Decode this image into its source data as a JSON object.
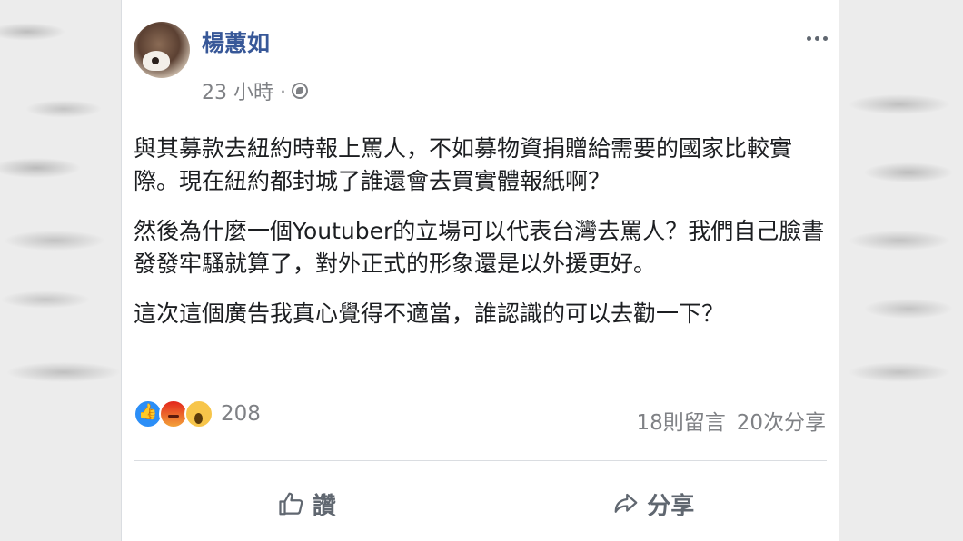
{
  "post": {
    "author": "楊蕙如",
    "timestamp": "23 小時 ·",
    "paragraphs": [
      "與其募款去紐約時報上罵人，不如募物資捐贈給需要的國家比較實際。現在紐約都封城了誰還會去買實體報紙啊？",
      "然後為什麼一個Youtuber的立場可以代表台灣去罵人？我們自己臉書發發牢騷就算了，對外正式的形象還是以外援更好。",
      "這次這個廣告我真心覺得不適當，誰認識的可以去勸一下？"
    ]
  },
  "reactions": {
    "count": "208",
    "types": [
      "like",
      "angry",
      "wow"
    ]
  },
  "stats": {
    "comments": "18則留言",
    "shares": "20次分享"
  },
  "actions": {
    "like_label": "讚",
    "share_label": "分享"
  },
  "icons": {
    "privacy": "globe-icon",
    "more": "more-options-icon",
    "like": "thumbs-up-icon",
    "share": "share-arrow-icon"
  },
  "colors": {
    "author": "#385898",
    "text": "#1c1e21",
    "meta": "#7f8185",
    "like_reaction": "#2b8ef7"
  }
}
